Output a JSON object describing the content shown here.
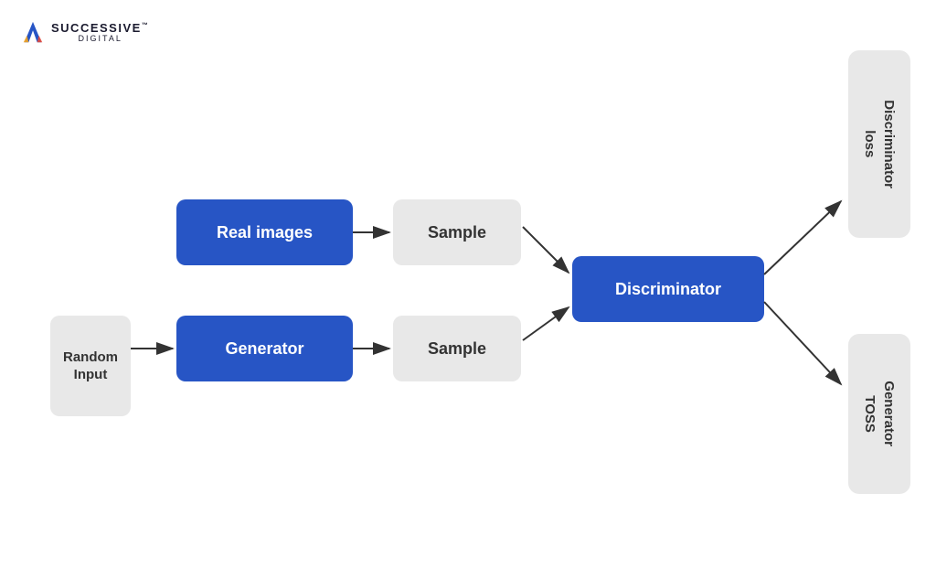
{
  "logo": {
    "successive": "SUCCESSIVE",
    "tm": "™",
    "digital": "DIGITAL"
  },
  "diagram": {
    "real_images_label": "Real images",
    "sample_top_label": "Sample",
    "generator_label": "Generator",
    "sample_bottom_label": "Sample",
    "random_input_label": "Random Input",
    "discriminator_label": "Discriminator",
    "discriminator_loss_label": "Discriminator loss",
    "generator_loss_label": "Generator TOSS"
  },
  "colors": {
    "blue": "#2755c5",
    "gray": "#e8e8e8",
    "arrow": "#333333"
  }
}
